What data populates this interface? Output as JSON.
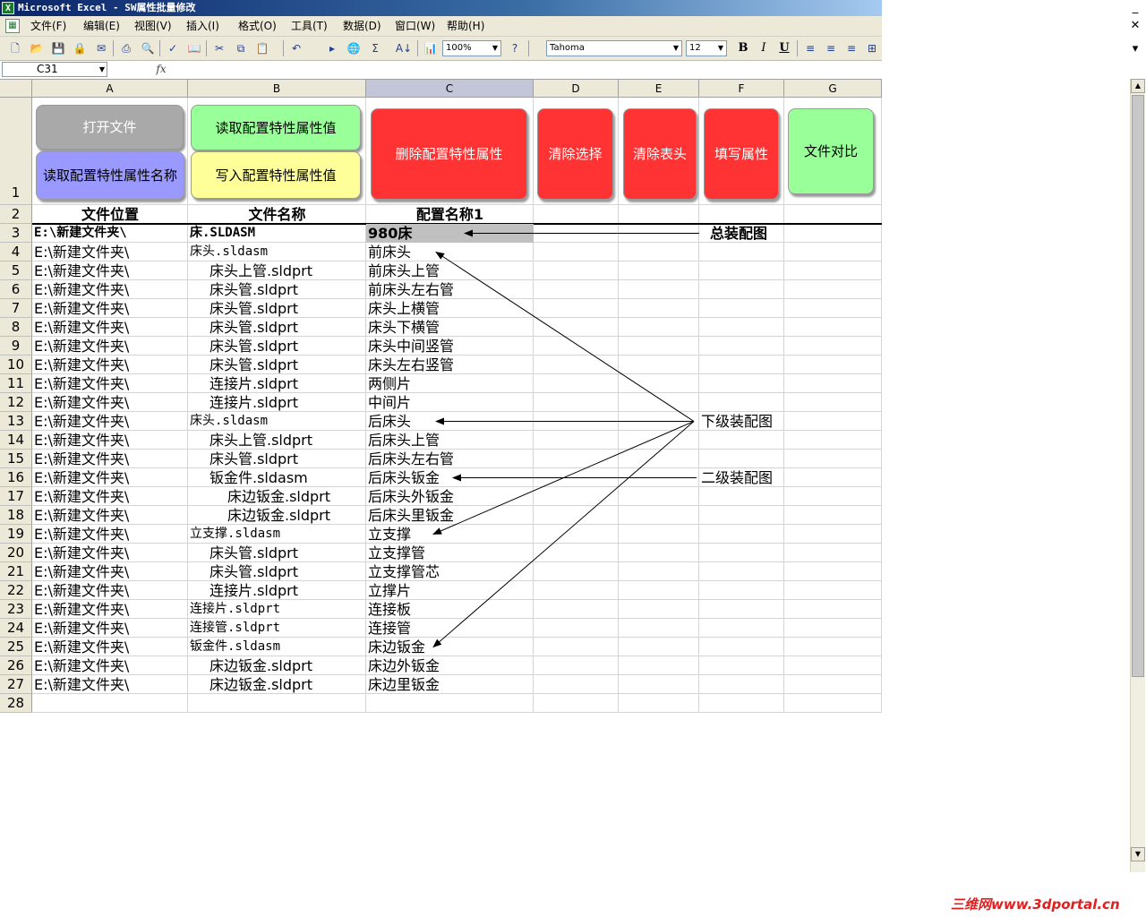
{
  "window": {
    "title": "Microsoft Excel - SW属性批量修改",
    "app_icon": "excel-icon"
  },
  "menu": [
    "文件(F)",
    "编辑(E)",
    "视图(V)",
    "插入(I)",
    "格式(O)",
    "工具(T)",
    "数据(D)",
    "窗口(W)",
    "帮助(H)"
  ],
  "toolbar": {
    "zoom": "100%",
    "font_name": "Tahoma",
    "font_size": "12",
    "bold": "B",
    "italic": "I",
    "underline": "U",
    "sum_symbol": "Σ",
    "sort_symbol": "A↓"
  },
  "formula_bar": {
    "name_box": "C31",
    "fx_label": "fx",
    "content": ""
  },
  "columns": [
    "A",
    "B",
    "C",
    "D",
    "E",
    "F",
    "G"
  ],
  "rows": [
    "1",
    "2",
    "3",
    "4",
    "5",
    "6",
    "7",
    "8",
    "9",
    "10",
    "11",
    "12",
    "13",
    "14",
    "15",
    "16",
    "17",
    "18",
    "19",
    "20",
    "21",
    "22",
    "23",
    "24",
    "25",
    "26",
    "27",
    "28"
  ],
  "buttons": {
    "open_file": "打开文件",
    "read_prop_names": "读取配置特性属性名称",
    "read_prop_values": "读取配置特性属性值",
    "write_prop_values": "写入配置特性属性值",
    "delete_props": "删除配置特性属性",
    "clear_selection": "清除选择",
    "clear_header": "清除表头",
    "fill_props": "填写属性",
    "compare_files": "文件对比"
  },
  "header_row": {
    "a": "文件位置",
    "b": "文件名称",
    "c": "配置名称1"
  },
  "data_rows": [
    {
      "a": "E:\\新建文件夹\\",
      "b": "床.SLDASM",
      "c": "980床"
    },
    {
      "a": "E:\\新建文件夹\\",
      "b": "床头.sldasm",
      "c": "前床头"
    },
    {
      "a": "E:\\新建文件夹\\",
      "b": "床头上管.sldprt",
      "c": "前床头上管"
    },
    {
      "a": "E:\\新建文件夹\\",
      "b": "床头管.sldprt",
      "c": "前床头左右管"
    },
    {
      "a": "E:\\新建文件夹\\",
      "b": "床头管.sldprt",
      "c": "床头上横管"
    },
    {
      "a": "E:\\新建文件夹\\",
      "b": "床头管.sldprt",
      "c": "床头下横管"
    },
    {
      "a": "E:\\新建文件夹\\",
      "b": "床头管.sldprt",
      "c": "床头中间竖管"
    },
    {
      "a": "E:\\新建文件夹\\",
      "b": "床头管.sldprt",
      "c": "床头左右竖管"
    },
    {
      "a": "E:\\新建文件夹\\",
      "b": "连接片.sldprt",
      "c": "两侧片"
    },
    {
      "a": "E:\\新建文件夹\\",
      "b": "连接片.sldprt",
      "c": "中间片"
    },
    {
      "a": "E:\\新建文件夹\\",
      "b": "床头.sldasm",
      "c": "后床头"
    },
    {
      "a": "E:\\新建文件夹\\",
      "b": "床头上管.sldprt",
      "c": "后床头上管"
    },
    {
      "a": "E:\\新建文件夹\\",
      "b": "床头管.sldprt",
      "c": "后床头左右管"
    },
    {
      "a": "E:\\新建文件夹\\",
      "b": "钣金件.sldasm",
      "c": "后床头钣金"
    },
    {
      "a": "E:\\新建文件夹\\",
      "b": "床边钣金.sldprt",
      "c": "后床头外钣金"
    },
    {
      "a": "E:\\新建文件夹\\",
      "b": "床边钣金.sldprt",
      "c": "后床头里钣金"
    },
    {
      "a": "E:\\新建文件夹\\",
      "b": "立支撑.sldasm",
      "c": "立支撑"
    },
    {
      "a": "E:\\新建文件夹\\",
      "b": "床头管.sldprt",
      "c": "立支撑管"
    },
    {
      "a": "E:\\新建文件夹\\",
      "b": "床头管.sldprt",
      "c": "立支撑管芯"
    },
    {
      "a": "E:\\新建文件夹\\",
      "b": "连接片.sldprt",
      "c": "立撑片"
    },
    {
      "a": "E:\\新建文件夹\\",
      "b": "连接片.sldprt",
      "c": "连接板"
    },
    {
      "a": "E:\\新建文件夹\\",
      "b": "连接管.sldprt",
      "c": "连接管"
    },
    {
      "a": "E:\\新建文件夹\\",
      "b": "钣金件.sldasm",
      "c": "床边钣金"
    },
    {
      "a": "E:\\新建文件夹\\",
      "b": "床边钣金.sldprt",
      "c": "床边外钣金"
    },
    {
      "a": "E:\\新建文件夹\\",
      "b": "床边钣金.sldprt",
      "c": "床边里钣金"
    }
  ],
  "annotations": {
    "top_assembly": "总装配图",
    "sub_assembly": "下级装配图",
    "second_level": "二级装配图"
  },
  "watermark": "三维网www.3dportal.cn",
  "colors": {
    "gray_button": "#a9a9a9",
    "blue_button": "#9999ff",
    "green_button": "#99ff99",
    "yellow_button": "#ffff99",
    "red_button": "#ff3333"
  }
}
